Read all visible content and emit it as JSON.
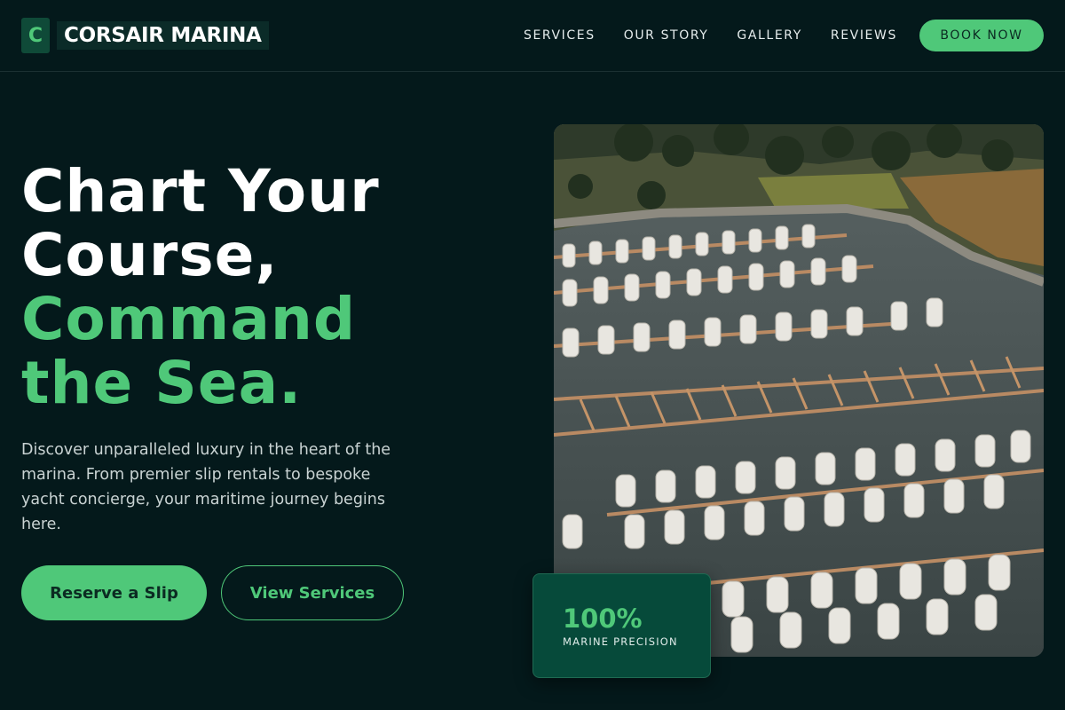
{
  "brand": {
    "mark": "C",
    "name": "CORSAIR MARINA"
  },
  "nav": {
    "links": [
      "SERVICES",
      "OUR STORY",
      "GALLERY",
      "REVIEWS"
    ],
    "cta": "BOOK NOW"
  },
  "hero": {
    "headline_line1": "Chart Your",
    "headline_line2": "Course,",
    "headline_line3": "Command",
    "headline_line4": "the Sea.",
    "description": "Discover unparalleled luxury in the heart of the marina. From premier slip rentals to bespoke yacht concierge, your maritime journey begins here.",
    "primary_button": "Reserve a Slip",
    "secondary_button": "View Services"
  },
  "stat": {
    "value": "100%",
    "label": "MARINE PRECISION"
  },
  "image": {
    "subject": "aerial view of marina with docked yachts"
  },
  "colors": {
    "background": "#04191b",
    "accent": "#4fc879",
    "card": "#064a3a"
  }
}
